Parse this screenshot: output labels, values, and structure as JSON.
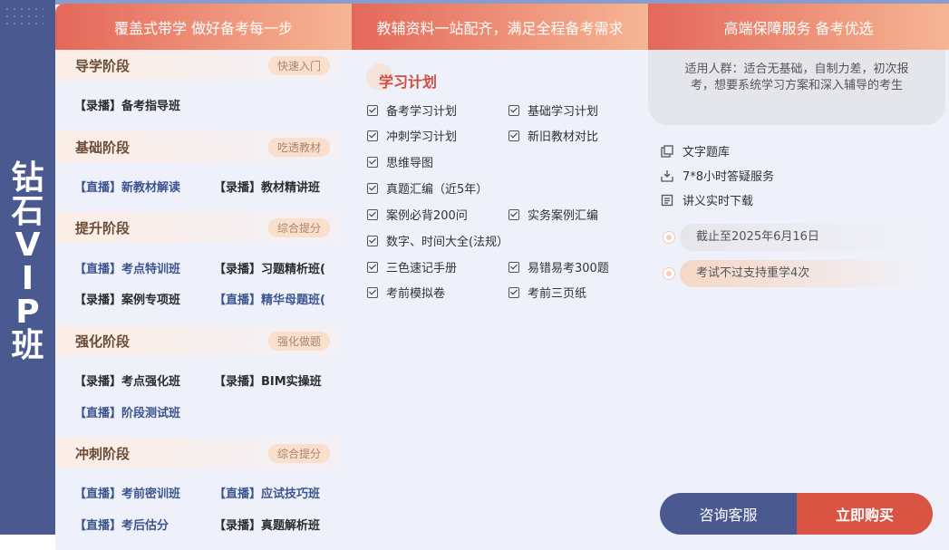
{
  "side_title": [
    "钻",
    "石",
    "V",
    "I",
    "P",
    "班"
  ],
  "headers": {
    "col1": "覆盖式带学 做好备考每一步",
    "col2": "教辅资料一站配齐，满足全程备考需求",
    "col3": "高端保障服务 备考优选"
  },
  "stages": [
    {
      "title": "导学阶段",
      "tag": "快速入门",
      "courses": [
        {
          "text": "【录播】备考指导班",
          "type": "rec"
        }
      ]
    },
    {
      "title": "基础阶段",
      "tag": "吃透教材",
      "courses": [
        {
          "text": "【直播】新教材解读",
          "type": "live"
        },
        {
          "text": "【录播】教材精讲班",
          "type": "rec"
        }
      ]
    },
    {
      "title": "提升阶段",
      "tag": "综合提分",
      "courses": [
        {
          "text": "【直播】考点特训班",
          "type": "live"
        },
        {
          "text": "【录播】习题精析班(",
          "type": "rec"
        },
        {
          "text": "【录播】案例专项班",
          "type": "rec"
        },
        {
          "text": "【直播】精华母题班(",
          "type": "live"
        }
      ]
    },
    {
      "title": "强化阶段",
      "tag": "强化做题",
      "courses": [
        {
          "text": "【录播】考点强化班",
          "type": "rec"
        },
        {
          "text": "【录播】BIM实操班",
          "type": "rec"
        },
        {
          "text": "【直播】阶段测试班",
          "type": "live"
        }
      ]
    },
    {
      "title": "冲刺阶段",
      "tag": "综合提分",
      "courses": [
        {
          "text": "【直播】考前密训班",
          "type": "live"
        },
        {
          "text": "【直播】应试技巧班",
          "type": "live"
        },
        {
          "text": "【直播】考后估分",
          "type": "live"
        },
        {
          "text": "【录播】真题解析班",
          "type": "rec"
        }
      ]
    }
  ],
  "plan": {
    "title": "学习计划",
    "items": [
      "备考学习计划",
      "基础学习计划",
      "冲刺学习计划",
      "新旧教材对比",
      "思维导图",
      "真题汇编（近5年）",
      "案例必背200问",
      "实务案例汇编",
      "数字、时间大全(法规）",
      "三色速记手册",
      "易错易考300题",
      "考前模拟卷",
      "考前三页纸"
    ]
  },
  "service": {
    "suitable": "适用人群：适合无基础，自制力差，初次报考，想要系统学习方案和深入辅导的考生",
    "features": [
      {
        "icon": "question-bank-icon",
        "text": "文字题库"
      },
      {
        "icon": "qa-service-icon",
        "text": "7*8小时答疑服务"
      },
      {
        "icon": "download-icon",
        "text": "讲义实时下载"
      }
    ],
    "deadline": "截止至2025年6月16日",
    "policy": "考试不过支持重学4次"
  },
  "buttons": {
    "consult": "咨询客服",
    "buy": "立即购买"
  }
}
